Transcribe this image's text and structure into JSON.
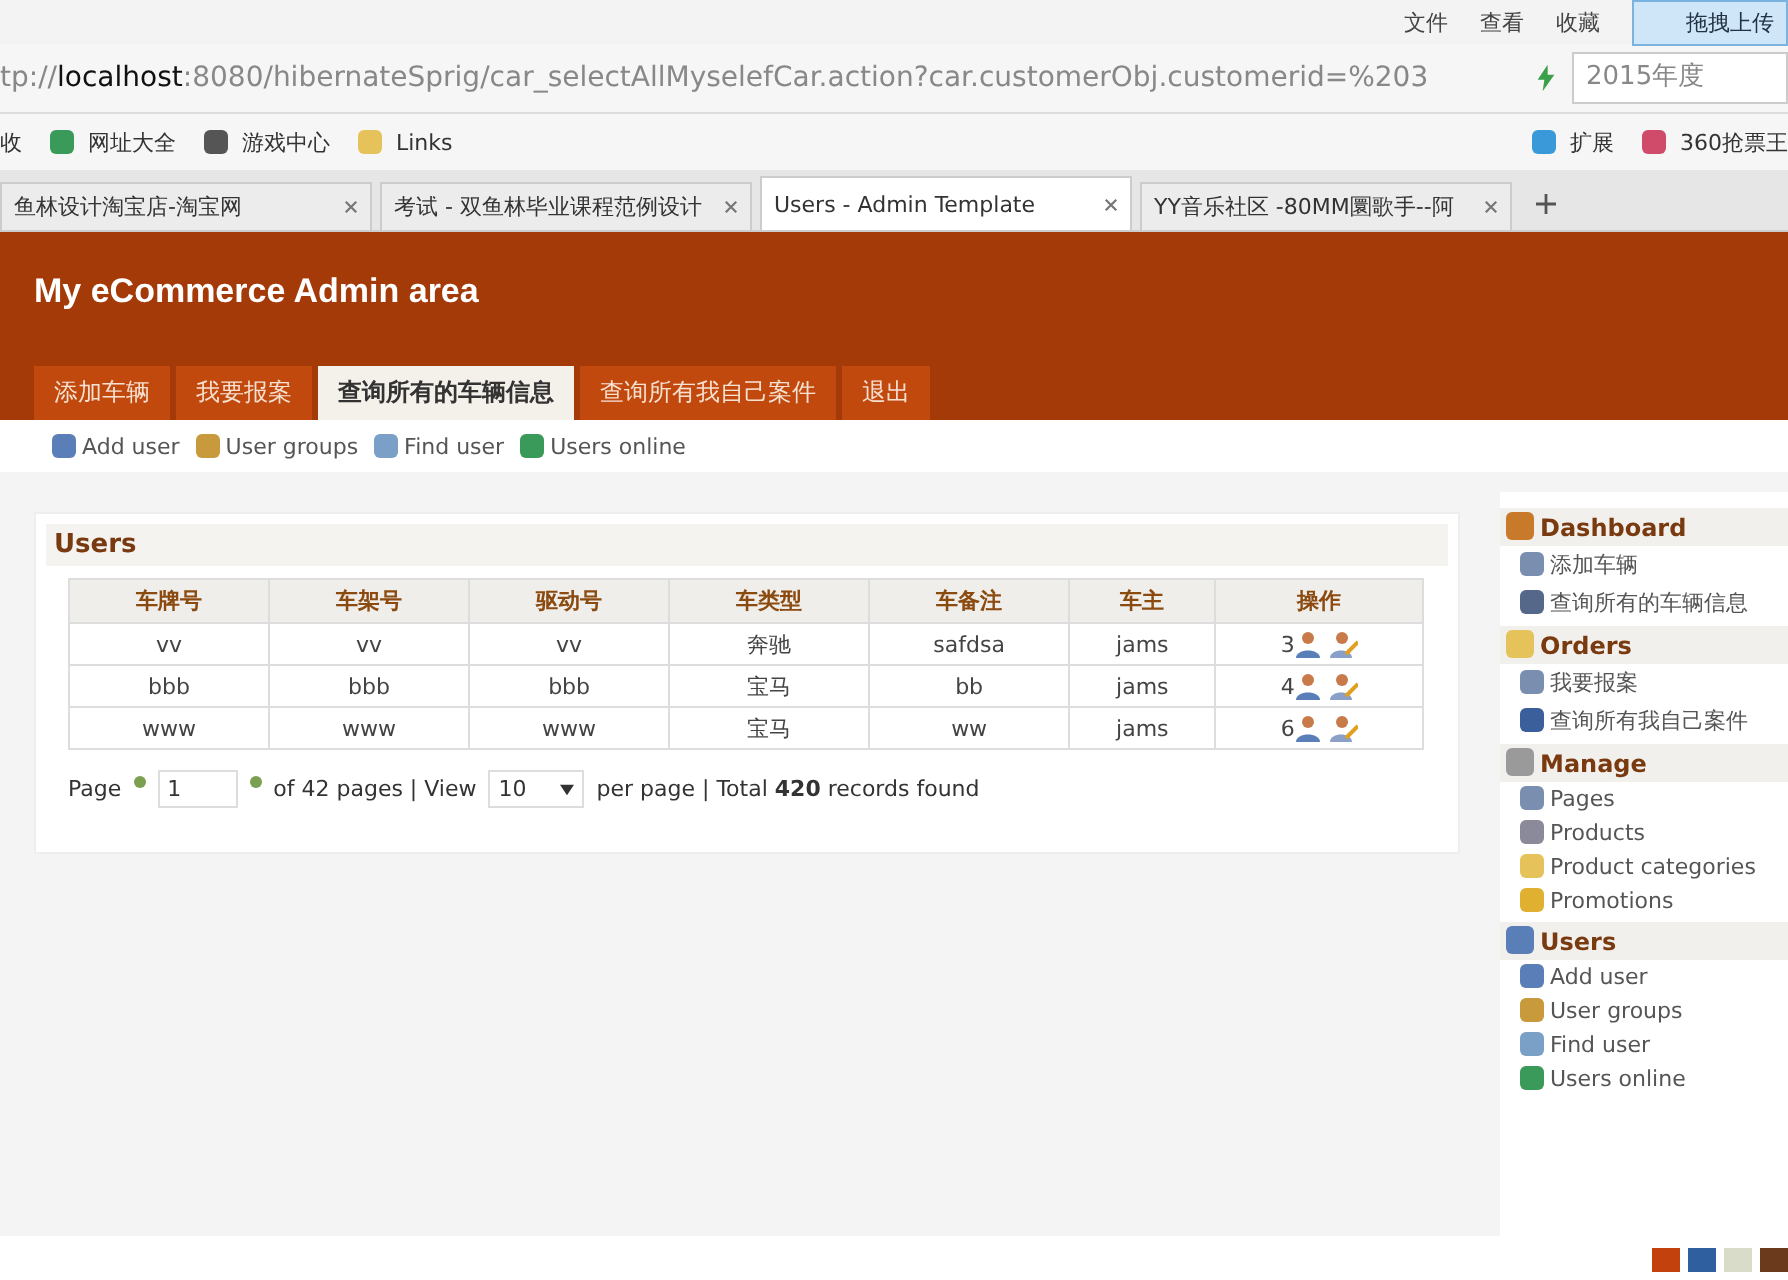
{
  "browser": {
    "menu": [
      "文件",
      "查看",
      "收藏"
    ],
    "upload_button": "拖拽上传",
    "address": {
      "prefix": "tp://",
      "host": "localhost",
      "rest": ":8080/hibernateSprig/car_selectAllMyselefCar.action?car.customerObj.customerid=%203"
    },
    "search_value": "2015年度",
    "bookmarks": [
      {
        "label": "收",
        "kind": "text"
      },
      {
        "label": "网址大全",
        "kind": "globe"
      },
      {
        "label": "游戏中心",
        "kind": "game"
      },
      {
        "label": "Links",
        "kind": "folder"
      }
    ],
    "bookmarks_right": [
      {
        "label": "扩展",
        "kind": "grid"
      },
      {
        "label": "360抢票王",
        "kind": "ticket"
      }
    ],
    "tabs": [
      {
        "label": "鱼林设计淘宝店-淘宝网",
        "selected": false
      },
      {
        "label": "考试 - 双鱼林毕业课程范例设计",
        "selected": false
      },
      {
        "label": "Users - Admin Template",
        "selected": true
      },
      {
        "label": "YY音乐社区 -80MM圜歌手--阿",
        "selected": false
      }
    ]
  },
  "header": {
    "title": "My eCommerce Admin area"
  },
  "nav_tabs": [
    {
      "label": "添加车辆",
      "selected": false
    },
    {
      "label": "我要报案",
      "selected": false
    },
    {
      "label": "查询所有的车辆信息",
      "selected": true
    },
    {
      "label": "查询所有我自己案件",
      "selected": false
    },
    {
      "label": "退出",
      "selected": false
    }
  ],
  "sub_nav": [
    {
      "label": "Add user",
      "kind": "person"
    },
    {
      "label": "User groups",
      "kind": "group"
    },
    {
      "label": "Find user",
      "kind": "search"
    },
    {
      "label": "Users online",
      "kind": "globe"
    }
  ],
  "panel": {
    "title": "Users",
    "table": {
      "columns": [
        "车牌号",
        "车架号",
        "驱动号",
        "车类型",
        "车备注",
        "车主",
        "操作"
      ],
      "rows": [
        [
          "vv",
          "vv",
          "vv",
          "奔驰",
          "safdsa",
          "jams",
          "3"
        ],
        [
          "bbb",
          "bbb",
          "bbb",
          "宝马",
          "bb",
          "jams",
          "4"
        ],
        [
          "www",
          "www",
          "www",
          "宝马",
          "ww",
          "jams",
          "6"
        ]
      ]
    },
    "pager": {
      "page_label": "Page",
      "page_value": "1",
      "of_pages": "of 42 pages | View",
      "per_page": "10",
      "per_page_label": "per page | Total",
      "total": "420",
      "records_label": "records found"
    }
  },
  "sidebar": [
    {
      "title": "Dashboard",
      "kind": "home",
      "items": [
        {
          "label": "添加车辆",
          "kind": "page"
        },
        {
          "label": "查询所有的车辆信息",
          "kind": "monitor"
        }
      ]
    },
    {
      "title": "Orders",
      "kind": "folder",
      "items": [
        {
          "label": "我要报案",
          "kind": "page"
        },
        {
          "label": "查询所有我自己案件",
          "kind": "car"
        }
      ]
    },
    {
      "title": "Manage",
      "kind": "gear",
      "items": [
        {
          "label": "Pages",
          "kind": "page"
        },
        {
          "label": "Products",
          "kind": "cart"
        },
        {
          "label": "Product categories",
          "kind": "folder"
        },
        {
          "label": "Promotions",
          "kind": "tag"
        }
      ]
    },
    {
      "title": "Users",
      "kind": "person",
      "items": [
        {
          "label": "Add user",
          "kind": "person"
        },
        {
          "label": "User groups",
          "kind": "group"
        },
        {
          "label": "Find user",
          "kind": "search"
        },
        {
          "label": "Users online",
          "kind": "globe"
        }
      ]
    }
  ],
  "theme_swatches": [
    {
      "color": "#c2410c"
    },
    {
      "color": "#2f5f9e"
    },
    {
      "color": "#d9dcc8"
    },
    {
      "color": "#6b3a1c"
    }
  ]
}
